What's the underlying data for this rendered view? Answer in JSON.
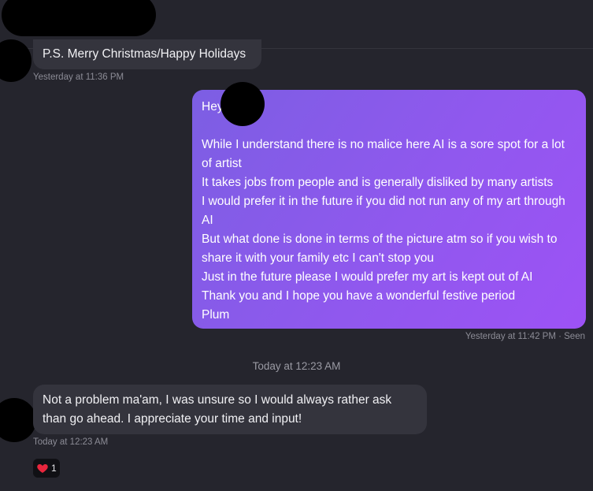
{
  "messages": [
    {
      "direction": "incoming",
      "text": "P.S. Merry Christmas/Happy Holidays",
      "timestamp": "Yesterday at 11:36 PM"
    },
    {
      "direction": "outgoing",
      "lines": [
        "Hey",
        "",
        "While I understand there is no malice here AI is a sore spot for a lot of artist",
        "It takes jobs from people and is generally disliked by many artists",
        "I would prefer it in the future if you did not run any of my art through AI",
        "But what done is done in terms of the picture atm so if you wish to share it with your family etc I can't stop you",
        "Just in the future please I would prefer my art is kept out of AI",
        "Thank you and I hope you have a wonderful festive period",
        "Plum"
      ],
      "timestamp": "Yesterday at 11:42 PM · Seen"
    },
    {
      "direction": "incoming",
      "text": "Not a problem ma'am, I was unsure so I would always rather ask than go ahead. I appreciate your time and input!",
      "timestamp": "Today at 12:23 AM",
      "reaction": {
        "icon": "heart-icon",
        "count": "1"
      }
    }
  ],
  "day_separator": "Today at 12:23 AM",
  "colors": {
    "background": "#25252d",
    "incoming_bubble": "#34343d",
    "outgoing_gradient_start": "#7c5ee3",
    "outgoing_gradient_end": "#9d52f5",
    "redaction": "#000000"
  }
}
